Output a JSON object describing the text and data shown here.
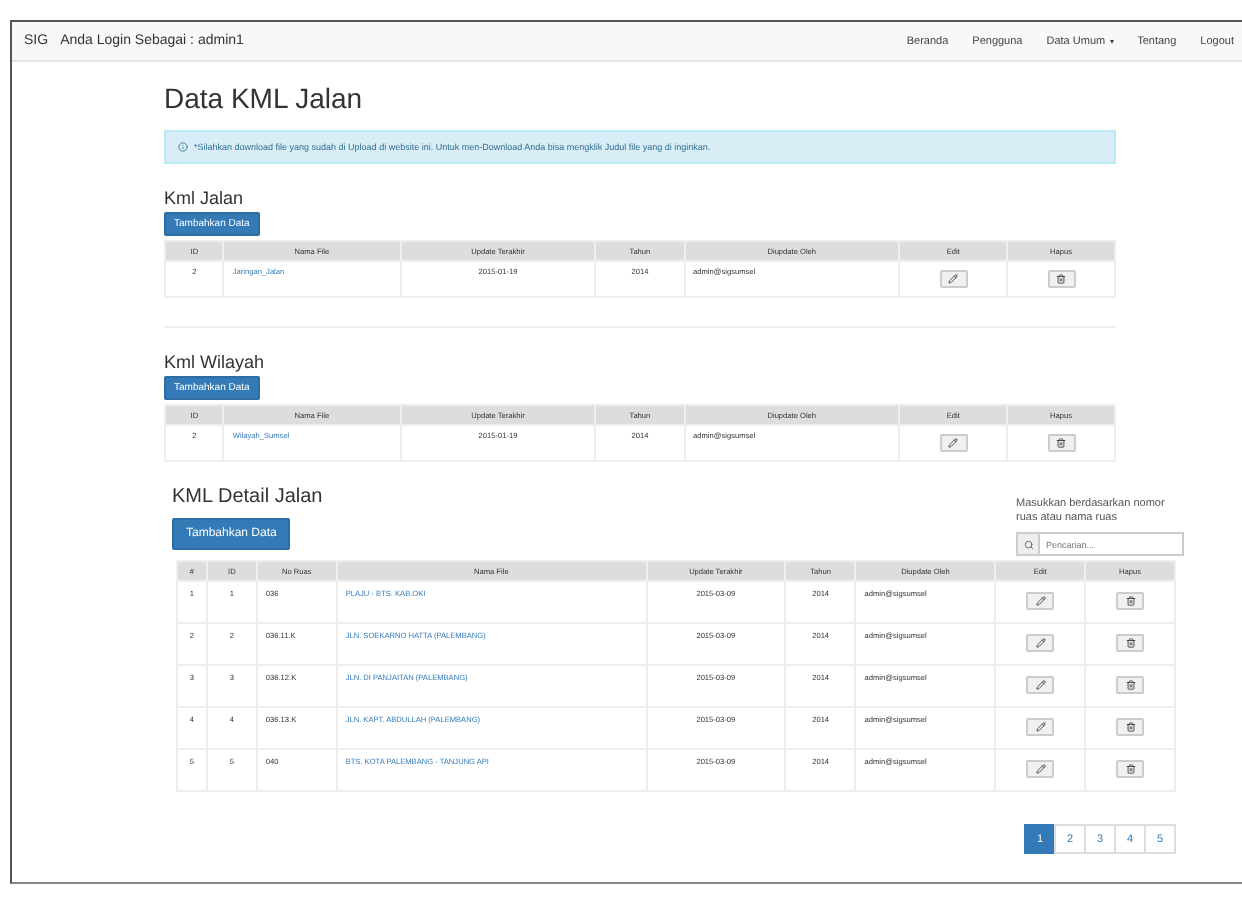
{
  "navbar": {
    "brand": "SIG",
    "login": "Anda Login Sebagai : admin1",
    "menu": [
      {
        "label": "Beranda",
        "dropdown": false
      },
      {
        "label": "Pengguna",
        "dropdown": false
      },
      {
        "label": "Data Umum",
        "dropdown": true
      },
      {
        "label": "Tentang",
        "dropdown": false
      },
      {
        "label": "Logout",
        "dropdown": false
      }
    ]
  },
  "title": "Data KML Jalan",
  "alert": "*Silahkan download file yang sudah di Upload di website ini. Untuk men-Download Anda bisa mengklik Judul file yang di inginkan.",
  "sections": [
    {
      "heading": "Kml Jalan",
      "button": "Tambahkan Data",
      "columns": [
        "ID",
        "Nama File",
        "Update Terakhir",
        "Tahun",
        "Diupdate Oleh",
        "Edit",
        "Hapus"
      ],
      "rows": [
        {
          "id": "2",
          "file": "Jaringan_Jalan",
          "updated": "2015-01-19",
          "year": "2014",
          "by": "admin@sigsumsel"
        }
      ]
    },
    {
      "heading": "Kml Wilayah",
      "button": "Tambahkan Data",
      "columns": [
        "ID",
        "Nama File",
        "Update Terakhir",
        "Tahun",
        "Diupdate Oleh",
        "Edit",
        "Hapus"
      ],
      "rows": [
        {
          "id": "2",
          "file": "Wilayah_Sumsel",
          "updated": "2015-01-19",
          "year": "2014",
          "by": "admin@sigsumsel"
        }
      ]
    }
  ],
  "detail": {
    "heading": "KML Detail Jalan",
    "button": "Tambahkan Data",
    "search_hint": "Masukkan berdasarkan nomor ruas atau nama ruas",
    "search": {
      "placeholder": "Pencarian..."
    },
    "columns": [
      "#",
      "ID",
      "No Ruas",
      "Nama File",
      "Update Terakhir",
      "Tahun",
      "Diupdate Oleh",
      "Edit",
      "Hapus"
    ],
    "rows": [
      {
        "no": "1",
        "id": "1",
        "ruas": "036",
        "file": "PLAJU - BTS. KAB.OKI",
        "updated": "2015-03-09",
        "year": "2014",
        "by": "admin@sigsumsel"
      },
      {
        "no": "2",
        "id": "2",
        "ruas": "036.11.K",
        "file": "JLN. SOEKARNO HATTA (PALEMBANG)",
        "updated": "2015-03-09",
        "year": "2014",
        "by": "admin@sigsumsel"
      },
      {
        "no": "3",
        "id": "3",
        "ruas": "036.12.K",
        "file": "JLN. DI PANJAITAN (PALEMBANG)",
        "updated": "2015-03-09",
        "year": "2014",
        "by": "admin@sigsumsel"
      },
      {
        "no": "4",
        "id": "4",
        "ruas": "036.13.K",
        "file": "JLN. KAPT. ABDULLAH (PALEMBANG)",
        "updated": "2015-03-09",
        "year": "2014",
        "by": "admin@sigsumsel"
      },
      {
        "no": "5",
        "id": "5",
        "ruas": "040",
        "file": "BTS. KOTA PALEMBANG - TANJUNG API",
        "updated": "2015-03-09",
        "year": "2014",
        "by": "admin@sigsumsel"
      }
    ]
  },
  "pagination": [
    {
      "label": "1",
      "selected": true
    },
    {
      "label": "2",
      "selected": false
    },
    {
      "label": "3",
      "selected": false
    },
    {
      "label": "4",
      "selected": false
    },
    {
      "label": "5",
      "selected": false
    }
  ]
}
